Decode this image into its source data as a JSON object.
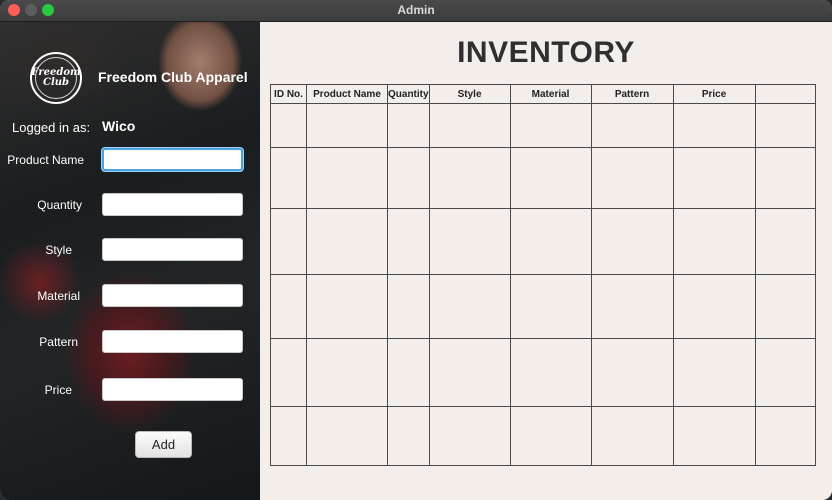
{
  "window": {
    "title": "Admin"
  },
  "brand": {
    "name": "Freedom Club Apparel",
    "logo_line1": "Freedom",
    "logo_line2": "Club"
  },
  "session": {
    "logged_in_label": "Logged in as:",
    "username": "Wico"
  },
  "form": {
    "fields": [
      {
        "label": "Product Name",
        "value": ""
      },
      {
        "label": "Quantity",
        "value": ""
      },
      {
        "label": "Style",
        "value": ""
      },
      {
        "label": "Material",
        "value": ""
      },
      {
        "label": "Pattern",
        "value": ""
      },
      {
        "label": "Price",
        "value": ""
      }
    ],
    "add_label": "Add"
  },
  "inventory": {
    "title": "INVENTORY",
    "columns": [
      "ID No.",
      "Product Name",
      "Quantity",
      "Style",
      "Material",
      "Pattern",
      "Price",
      ""
    ],
    "rows": [
      [
        "",
        "",
        "",
        "",
        "",
        "",
        "",
        ""
      ],
      [
        "",
        "",
        "",
        "",
        "",
        "",
        "",
        ""
      ],
      [
        "",
        "",
        "",
        "",
        "",
        "",
        "",
        ""
      ],
      [
        "",
        "",
        "",
        "",
        "",
        "",
        "",
        ""
      ],
      [
        "",
        "",
        "",
        "",
        "",
        "",
        "",
        ""
      ],
      [
        "",
        "",
        "",
        "",
        "",
        "",
        "",
        ""
      ]
    ]
  }
}
